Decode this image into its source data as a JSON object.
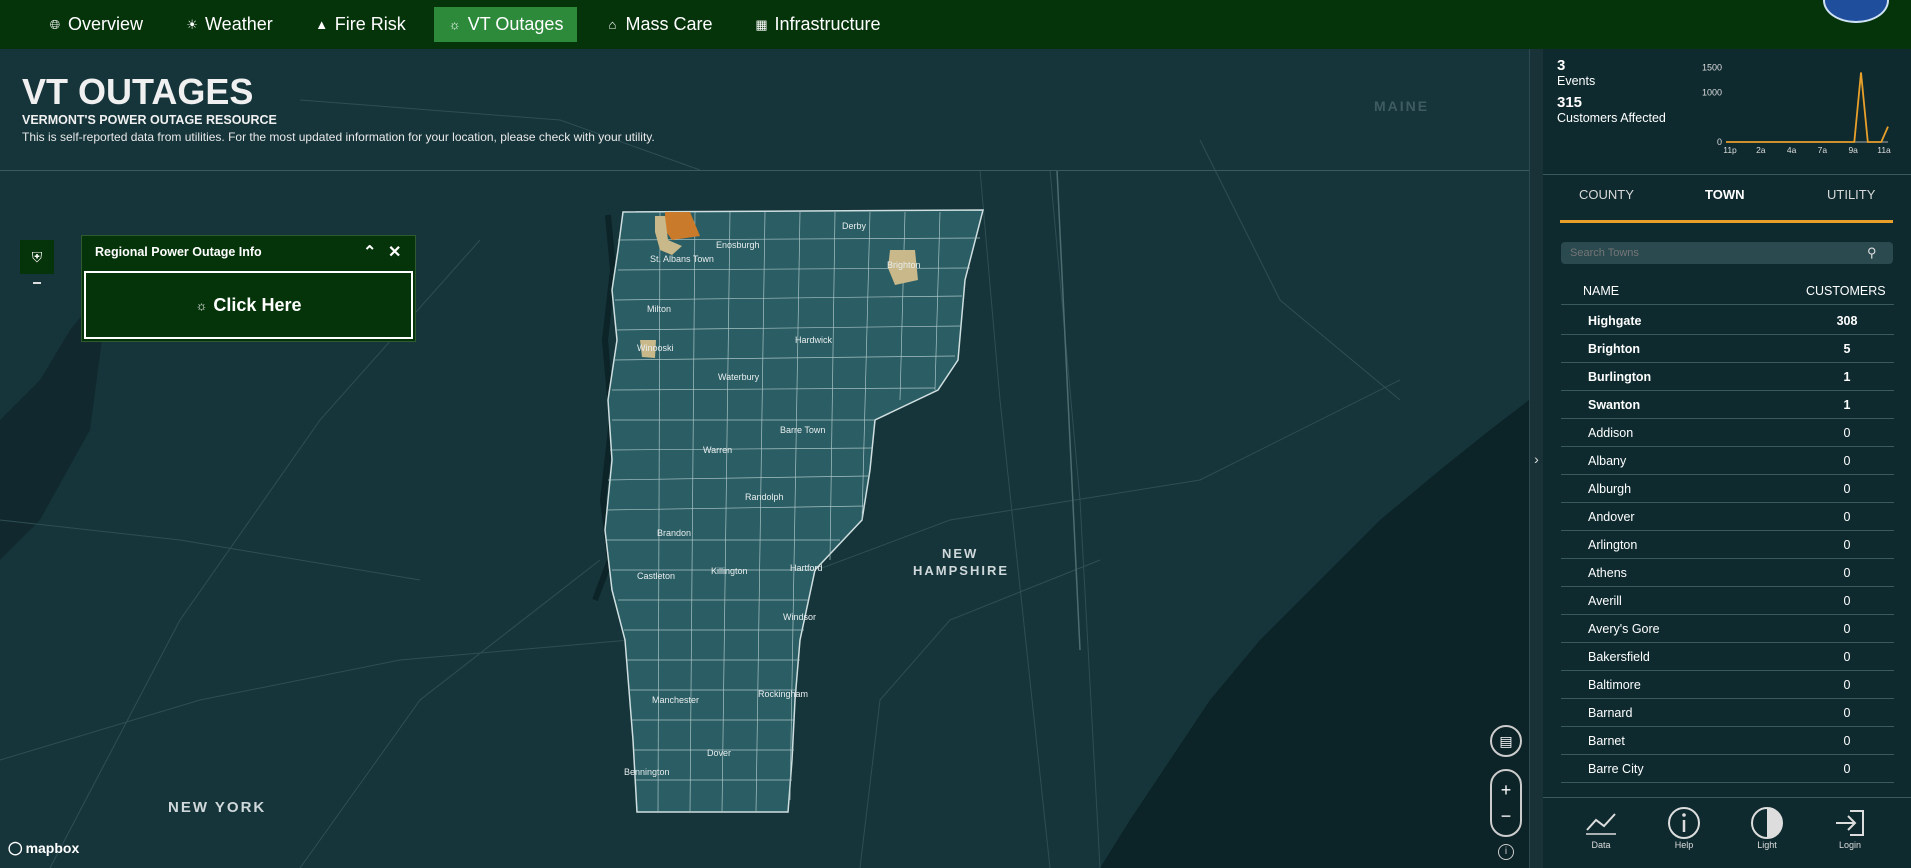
{
  "nav": {
    "items": [
      {
        "label": "Overview",
        "icon": "globe-icon",
        "active": false
      },
      {
        "label": "Weather",
        "icon": "sun-icon",
        "active": false
      },
      {
        "label": "Fire Risk",
        "icon": "warning-icon",
        "active": false
      },
      {
        "label": "VT Outages",
        "icon": "lightbulb-icon",
        "active": true
      },
      {
        "label": "Mass Care",
        "icon": "house-icon",
        "active": false
      },
      {
        "label": "Infrastructure",
        "icon": "building-icon",
        "active": false
      }
    ]
  },
  "header": {
    "title": "VT OUTAGES",
    "subtitle": "VERMONT'S POWER OUTAGE RESOURCE",
    "disclaimer": "This is self-reported data from utilities. For the most updated information for your location, please check with your utility."
  },
  "infopanel": {
    "title": "Regional Power Outage Info",
    "button_label": "Click Here"
  },
  "map": {
    "state_labels": {
      "maine": "MAINE",
      "new_hampshire_1": "NEW",
      "new_hampshire_2": "HAMPSHIRE",
      "new_york": "NEW YORK"
    },
    "town_labels": [
      "Derby",
      "Enosburgh",
      "St. Albans Town",
      "Brighton",
      "Milton",
      "Winooski",
      "Hardwick",
      "Waterbury",
      "Barre Town",
      "Warren",
      "Randolph",
      "Brandon",
      "Castleton",
      "Killington",
      "Hartford",
      "Windsor",
      "Manchester",
      "Rockingham",
      "Dover",
      "Bennington"
    ],
    "attribution": "mapbox",
    "colors": {
      "land": "#1c4a50",
      "water": "#0c2327",
      "vermont": "#2a5d64",
      "high": "#c97a2a",
      "low": "#c8b88a"
    }
  },
  "summary": {
    "events_count": "3",
    "events_label": "Events",
    "customers_count": "315",
    "customers_label": "Customers Affected"
  },
  "chart_data": {
    "type": "line",
    "x": [
      "11p",
      "2a",
      "4a",
      "7a",
      "9a",
      "11a"
    ],
    "y_ticks": [
      "0",
      "1000",
      "1500"
    ],
    "ylim": [
      0,
      1500
    ],
    "series": [
      {
        "values": [
          0,
          0,
          0,
          0,
          0,
          0,
          0,
          0,
          0,
          0,
          0,
          0,
          0,
          0,
          0,
          0,
          0,
          0,
          0,
          0,
          1400,
          0,
          0,
          0,
          310
        ]
      }
    ],
    "color": "#e8a02a"
  },
  "tabs": [
    {
      "label": "COUNTY",
      "active": false
    },
    {
      "label": "TOWN",
      "active": true
    },
    {
      "label": "UTILITY",
      "active": false
    }
  ],
  "search": {
    "placeholder": "Search Towns"
  },
  "table": {
    "headers": {
      "name": "NAME",
      "customers": "CUSTOMERS"
    },
    "rows": [
      {
        "name": "Highgate",
        "customers": "308",
        "bold": true
      },
      {
        "name": "Brighton",
        "customers": "5",
        "bold": true
      },
      {
        "name": "Burlington",
        "customers": "1",
        "bold": true
      },
      {
        "name": "Swanton",
        "customers": "1",
        "bold": true
      },
      {
        "name": "Addison",
        "customers": "0",
        "bold": false
      },
      {
        "name": "Albany",
        "customers": "0",
        "bold": false
      },
      {
        "name": "Alburgh",
        "customers": "0",
        "bold": false
      },
      {
        "name": "Andover",
        "customers": "0",
        "bold": false
      },
      {
        "name": "Arlington",
        "customers": "0",
        "bold": false
      },
      {
        "name": "Athens",
        "customers": "0",
        "bold": false
      },
      {
        "name": "Averill",
        "customers": "0",
        "bold": false
      },
      {
        "name": "Avery's Gore",
        "customers": "0",
        "bold": false
      },
      {
        "name": "Bakersfield",
        "customers": "0",
        "bold": false
      },
      {
        "name": "Baltimore",
        "customers": "0",
        "bold": false
      },
      {
        "name": "Barnard",
        "customers": "0",
        "bold": false
      },
      {
        "name": "Barnet",
        "customers": "0",
        "bold": false
      },
      {
        "name": "Barre City",
        "customers": "0",
        "bold": false
      }
    ]
  },
  "bottombar": [
    {
      "label": "Data",
      "icon": "chart-line-icon"
    },
    {
      "label": "Help",
      "icon": "info-icon"
    },
    {
      "label": "Light",
      "icon": "contrast-icon"
    },
    {
      "label": "Login",
      "icon": "login-icon"
    }
  ]
}
